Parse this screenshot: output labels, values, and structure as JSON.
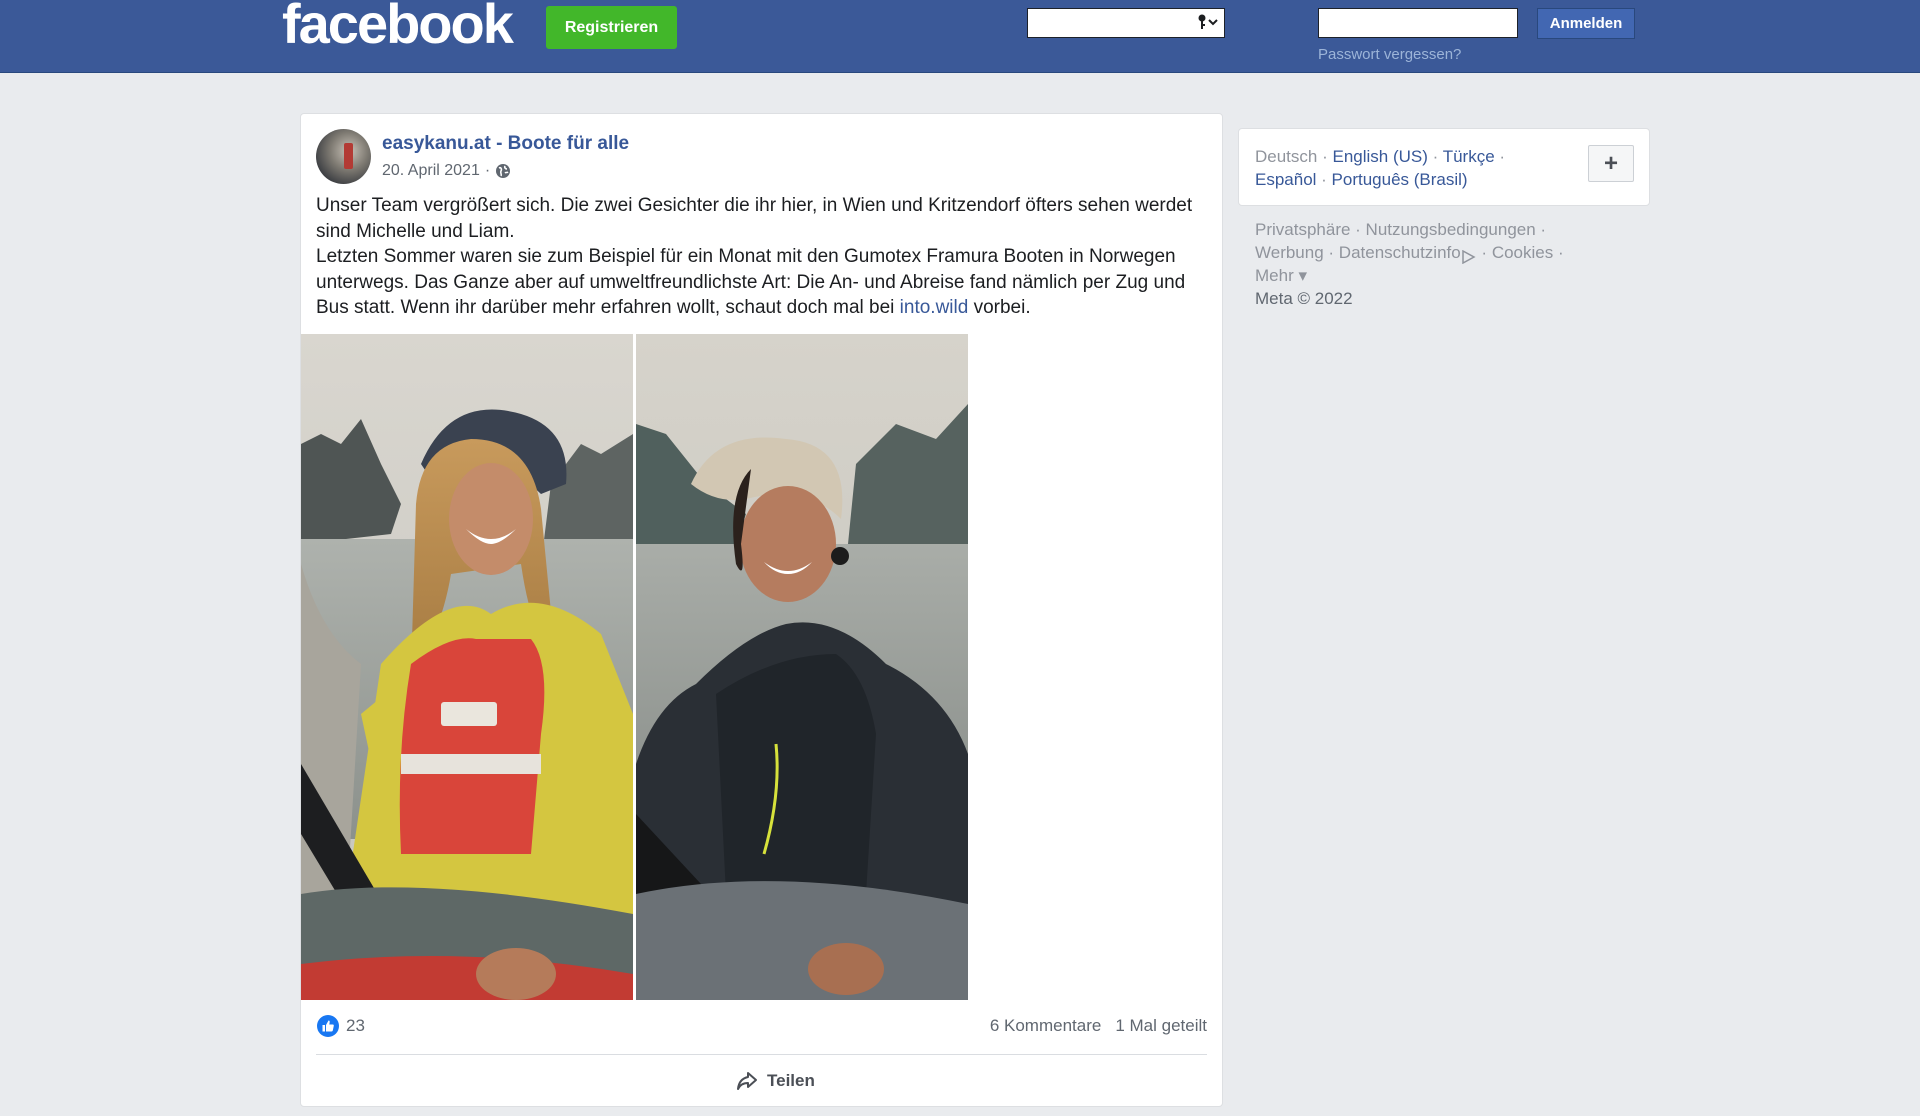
{
  "header": {
    "logo": "facebook",
    "register_label": "Registrieren",
    "email_value": "",
    "password_value": "",
    "login_label": "Anmelden",
    "forgot_label": "Passwort vergessen?"
  },
  "post": {
    "page_name": "easykanu.at - Boote für alle",
    "date": "20. April 2021",
    "separator": "·",
    "text_line1": "Unser Team vergrößert sich. Die zwei Gesichter die ihr hier, in Wien und Kritzendorf öfters sehen werdet sind Michelle und Liam.",
    "text_line2_before": "Letzten Sommer waren sie zum Beispiel für ein Monat mit den Gumotex Framura Booten in Norwegen unterwegs. Das Ganze aber auf umweltfreundlichste Art: Die An- und Abreise fand nämlich per Zug und Bus statt. Wenn ihr darüber mehr erfahren wollt, schaut doch mal bei ",
    "text_link": "into.wild",
    "text_line2_after": " vorbei.",
    "likes": "23",
    "comments": "6 Kommentare",
    "shares": "1 Mal geteilt",
    "share_label": "Teilen"
  },
  "sidebar": {
    "current_language": "Deutsch",
    "languages": [
      "English (US)",
      "Türkçe",
      "Español",
      "Português (Brasil)"
    ],
    "more_languages_label": "+",
    "footer": {
      "privacy": "Privatsphäre",
      "terms": "Nutzungsbedingungen",
      "ads": "Werbung",
      "data": "Datenschutzinfo",
      "cookies": "Cookies",
      "more": "Mehr",
      "copyright": "Meta © 2022"
    }
  },
  "colors": {
    "brand_blue": "#3b5998",
    "register_green": "#42b72a",
    "link_blue": "#385898",
    "like_blue": "#1877f2"
  }
}
